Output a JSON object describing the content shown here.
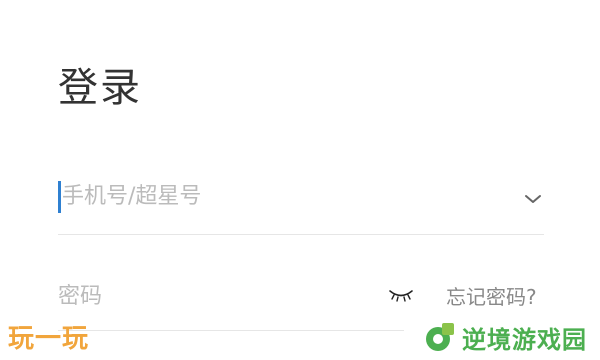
{
  "page": {
    "title": "登录"
  },
  "account": {
    "placeholder": "手机号/超星号",
    "dropdown_icon": "chevron-down-icon"
  },
  "password": {
    "placeholder": "密码",
    "visibility_icon": "eye-closed-icon",
    "forgot_label": "忘记密码?"
  },
  "watermarks": {
    "left_text": "玩一玩",
    "right_text": "逆境游戏园"
  },
  "colors": {
    "caret": "#2f80d1",
    "title": "#333333",
    "placeholder": "#bbbbbb",
    "watermark_left": "#f1a53c",
    "watermark_right": "#4caf50"
  }
}
